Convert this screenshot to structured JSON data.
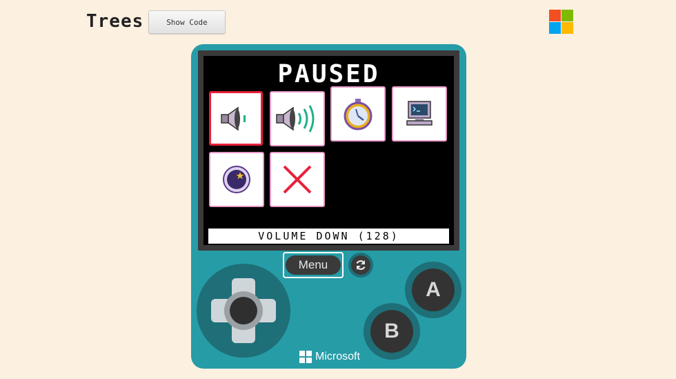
{
  "header": {
    "title": "Trees",
    "show_code_label": "Show Code"
  },
  "colors": {
    "background": "#fcf0e0",
    "device": "#269ca7",
    "ms_red": "#f25022",
    "ms_green": "#7fba00",
    "ms_blue": "#00a4ef",
    "ms_yellow": "#ffb900",
    "tile_border": "#e89ac8",
    "tile_selected_border": "#e8203a"
  },
  "screen": {
    "heading": "PAUSED",
    "status": "VOLUME DOWN (128)",
    "tiles": [
      {
        "icon": "volume-down-icon",
        "selected": true
      },
      {
        "icon": "volume-up-icon",
        "selected": false
      },
      {
        "icon": "stopwatch-icon",
        "selected": false
      },
      {
        "icon": "console-icon",
        "selected": false
      },
      {
        "icon": "sleep-moon-icon",
        "selected": false
      },
      {
        "icon": "close-x-icon",
        "selected": false
      }
    ]
  },
  "controls": {
    "menu_label": "Menu",
    "refresh_icon": "refresh-icon",
    "a_label": "A",
    "b_label": "B"
  },
  "brand": {
    "name": "Microsoft"
  }
}
